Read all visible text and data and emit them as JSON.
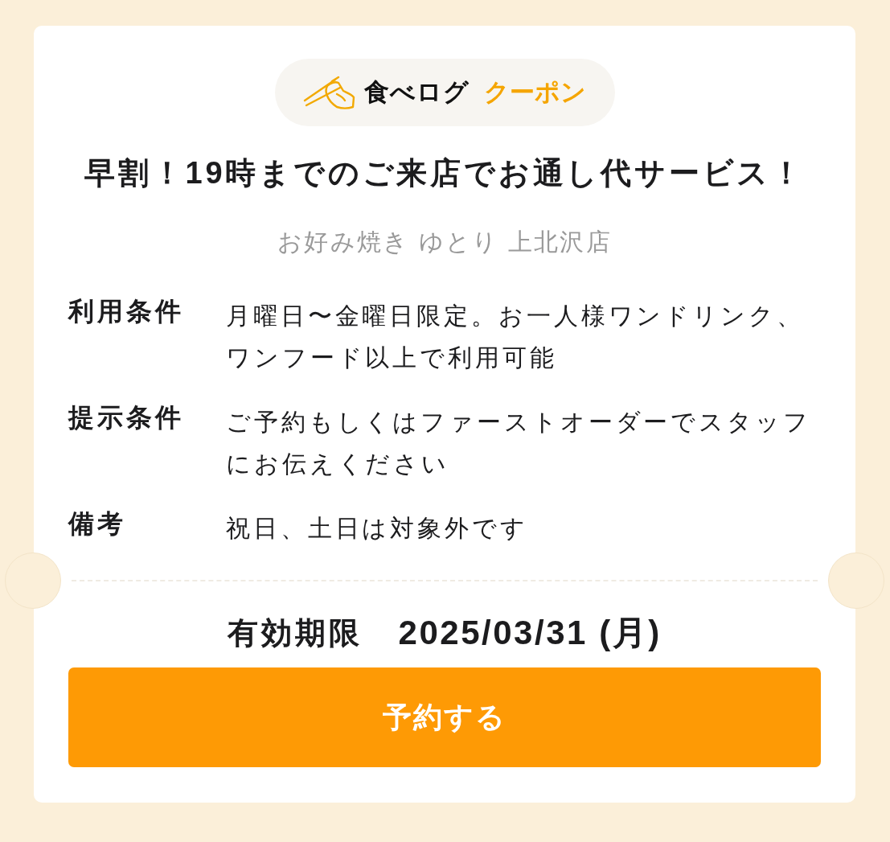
{
  "coupon_header": {
    "brand": "食べログ",
    "label": "クーポン"
  },
  "title": "早割！19時までのご来店でお通し代サービス！",
  "shop_name": "お好み焼き ゆとり 上北沢店",
  "conditions": [
    {
      "label": "利用条件",
      "value": "月曜日〜金曜日限定。お一人様ワンドリンク、ワンフード以上で利用可能"
    },
    {
      "label": "提示条件",
      "value": "ご予約もしくはファーストオーダーでスタッフにお伝えください"
    },
    {
      "label": "備考",
      "value": "祝日、土日は対象外です"
    }
  ],
  "expiry": {
    "label": "有効期限",
    "date": "2025/03/31 (月)"
  },
  "buttons": [
    {
      "label": "予約する"
    }
  ]
}
